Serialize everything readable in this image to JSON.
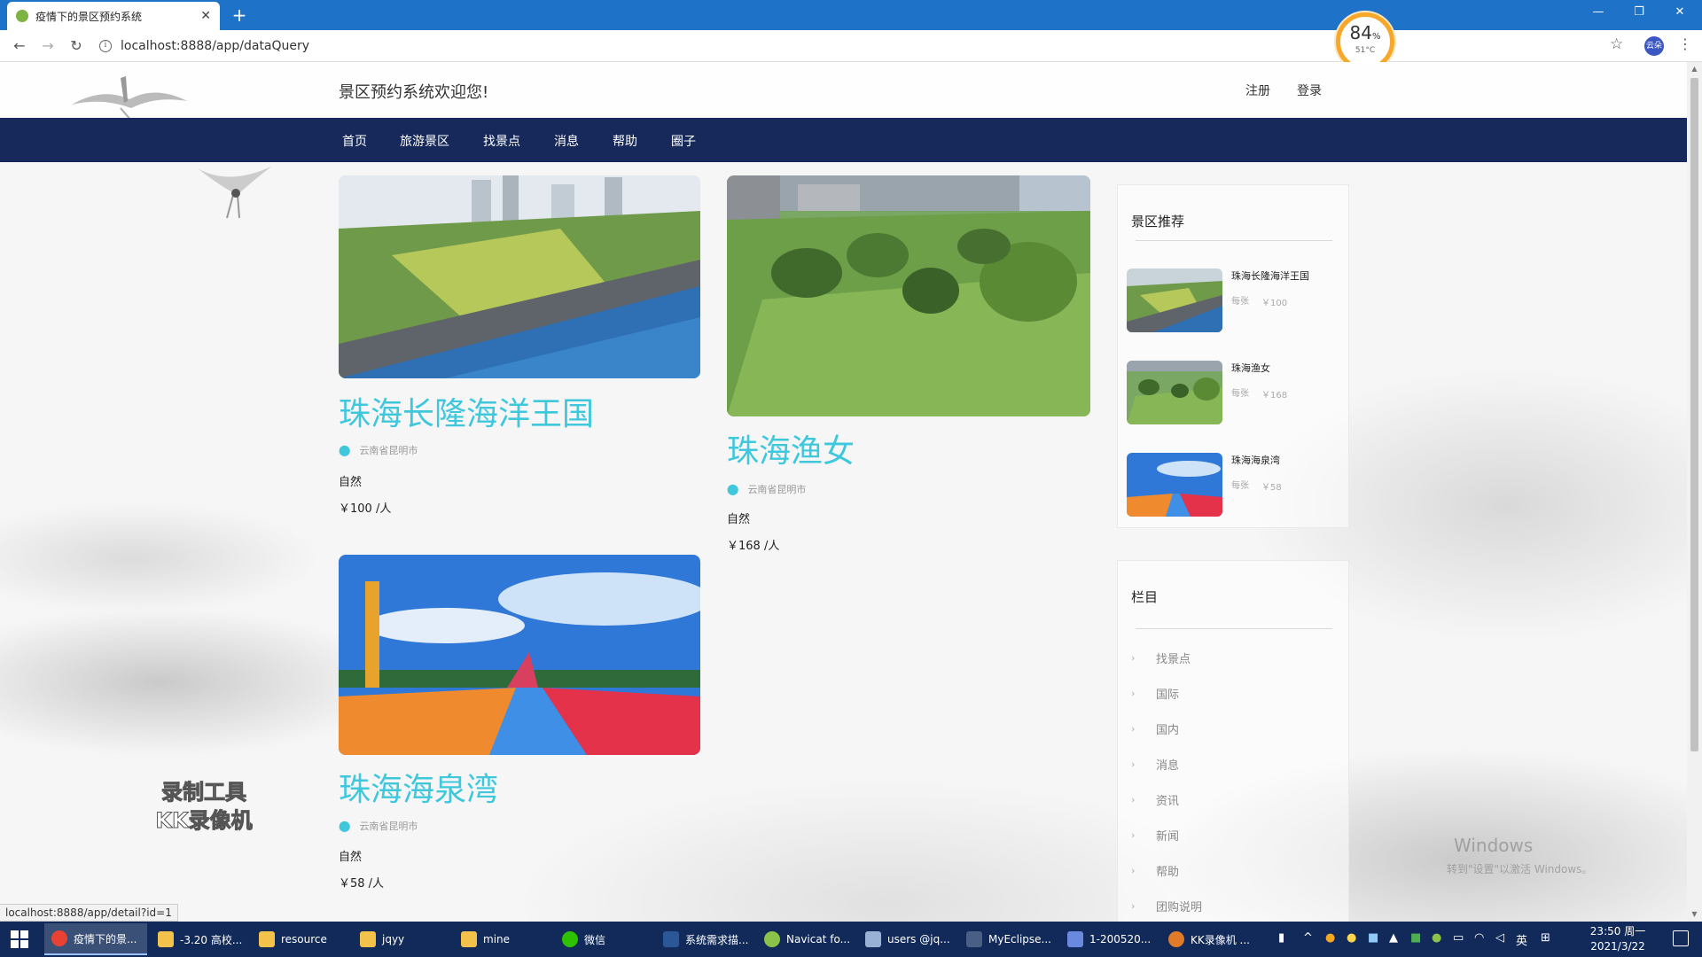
{
  "browser": {
    "tab_title": "疫情下的景区预约系统",
    "new_tab": "+",
    "close_glyph": "✕",
    "address": "localhost:8888/app/dataQuery",
    "info_glyph": "i",
    "star_glyph": "☆",
    "profile_label": "云朵",
    "menu_glyph": "⋮",
    "status_url": "localhost:8888/app/detail?id=1"
  },
  "window_controls": {
    "minimize": "—",
    "restore": "❐",
    "close": "✕"
  },
  "nav_buttons": {
    "back": "←",
    "forward": "→",
    "reload": "↻"
  },
  "gauge": {
    "percent": "84",
    "unit": "%",
    "temp": "51°C"
  },
  "site": {
    "welcome": "景区预约系统欢迎您!",
    "register": "注册",
    "login": "登录",
    "nav": [
      "首页",
      "旅游景区",
      "找景点",
      "消息",
      "帮助",
      "圈子"
    ]
  },
  "spots": [
    {
      "name": "珠海长隆海洋王国",
      "location": "云南省昆明市",
      "category": "自然",
      "price": "￥100 /人"
    },
    {
      "name": "珠海渔女",
      "location": "云南省昆明市",
      "category": "自然",
      "price": "￥168 /人"
    },
    {
      "name": "珠海海泉湾",
      "location": "云南省昆明市",
      "category": "自然",
      "price": "￥58 /人"
    }
  ],
  "sidebar": {
    "recommend_title": "景区推荐",
    "recommend": [
      {
        "name": "珠海长隆海洋王国",
        "unit": "每张",
        "price": "￥100"
      },
      {
        "name": "珠海渔女",
        "unit": "每张",
        "price": "￥168"
      },
      {
        "name": "珠海海泉湾",
        "unit": "每张",
        "price": "￥58"
      }
    ],
    "columns_title": "栏目",
    "columns": [
      "找景点",
      "国际",
      "国内",
      "消息",
      "资讯",
      "新闻",
      "帮助",
      "团购说明"
    ]
  },
  "overlays": {
    "recorder_line1": "录制工具",
    "recorder_line2": "KK录像机",
    "activate_title": "Windows",
    "activate_sub": "转到\"设置\"以激活 Windows。"
  },
  "taskbar": {
    "items": [
      "疫情下的景...",
      "-3.20 高校...",
      "resource",
      "jqyy",
      "mine",
      "微信",
      "系统需求描...",
      "Navicat fo...",
      "users @jq...",
      "MyEclipse...",
      "1-200520...",
      "KK录像机 ..."
    ],
    "ime": "英",
    "time": "23:50 周一",
    "date": "2021/3/22"
  },
  "colors": {
    "tabbar": "#1e73c9",
    "site_nav": "#16295a",
    "spot_title": "#3fc7dc",
    "taskbar": "#112a5a",
    "gauge_ring": "#f7a82a"
  }
}
